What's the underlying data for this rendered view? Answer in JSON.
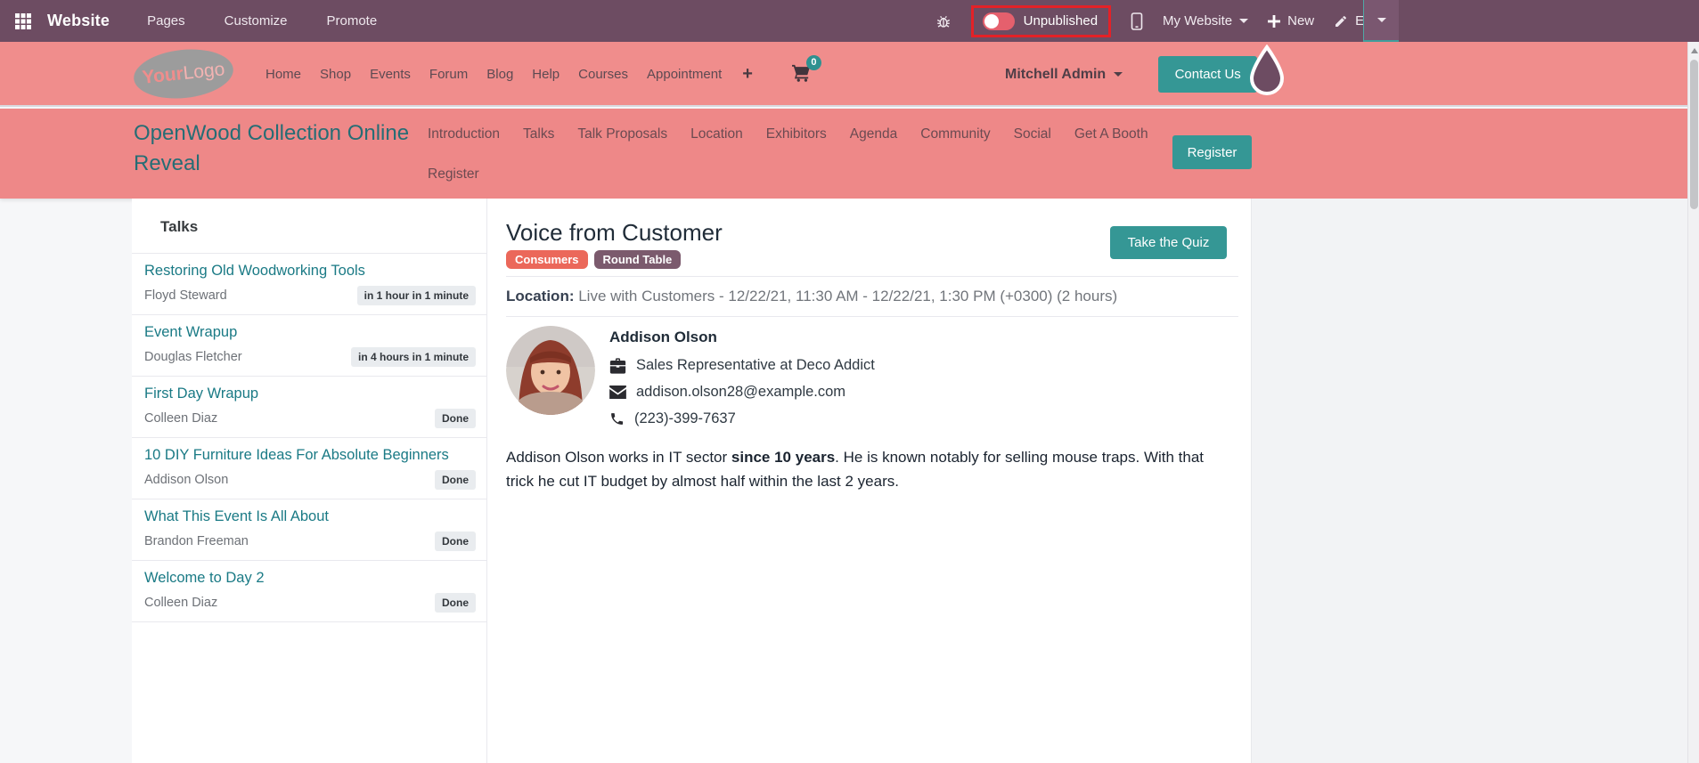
{
  "topbar": {
    "app_title": "Website",
    "menus": {
      "pages": "Pages",
      "customize": "Customize",
      "promote": "Promote"
    },
    "publish_status": "Unpublished",
    "my_website": "My Website",
    "new_label": "New",
    "edit_label": "Edit"
  },
  "navbar": {
    "logo": {
      "part1": "Your",
      "part2": "Logo"
    },
    "items": {
      "home": "Home",
      "shop": "Shop",
      "events": "Events",
      "forum": "Forum",
      "blog": "Blog",
      "help": "Help",
      "courses": "Courses",
      "appointment": "Appointment"
    },
    "cart_count": "0",
    "user_name": "Mitchell Admin",
    "contact_button": "Contact Us"
  },
  "event_header": {
    "title": "OpenWood Collection Online Reveal",
    "menu": {
      "introduction": "Introduction",
      "talks": "Talks",
      "talk_proposals": "Talk Proposals",
      "location": "Location",
      "exhibitors": "Exhibitors",
      "agenda": "Agenda",
      "community": "Community",
      "social": "Social",
      "get_a_booth": "Get A Booth",
      "register": "Register"
    },
    "register_button": "Register"
  },
  "sidebar": {
    "title": "Talks",
    "talks": [
      {
        "title": "Restoring Old Woodworking Tools",
        "speaker": "Floyd Steward",
        "status": "in 1 hour in 1 minute"
      },
      {
        "title": "Event Wrapup",
        "speaker": "Douglas Fletcher",
        "status": "in 4 hours in 1 minute"
      },
      {
        "title": "First Day Wrapup",
        "speaker": "Colleen Diaz",
        "status": "Done"
      },
      {
        "title": "10 DIY Furniture Ideas For Absolute Beginners",
        "speaker": "Addison Olson",
        "status": "Done"
      },
      {
        "title": "What This Event Is All About",
        "speaker": "Brandon Freeman",
        "status": "Done"
      },
      {
        "title": "Welcome to Day 2",
        "speaker": "Colleen Diaz",
        "status": "Done"
      }
    ]
  },
  "main": {
    "title": "Voice from Customer",
    "tags": [
      {
        "label": "Consumers",
        "color": "#eb685a"
      },
      {
        "label": "Round Table",
        "color": "#7b5a6d"
      }
    ],
    "quiz_button": "Take the Quiz",
    "location_label": "Location:",
    "location_value": " Live with Customers - 12/22/21, 11:30 AM - 12/22/21, 1:30 PM (+0300) (2 hours)",
    "speaker": {
      "name": "Addison Olson",
      "role": "Sales Representative at Deco Addict",
      "email": "addison.olson28@example.com",
      "phone": "(223)-399-7637",
      "bio_part1": "Addison Olson works in IT sector ",
      "bio_bold": "since 10 years",
      "bio_part2": ". He is known notably for selling mouse traps. With that trick he cut IT budget by almost half within the last 2 years."
    }
  },
  "colors": {
    "topbar_bg": "#6d4c62",
    "navbar_pink": "#f08d8c",
    "event_header_pink": "#ee8888",
    "accent_teal": "#359795",
    "alert_red": "#e42127",
    "toggle_red": "#e5606d",
    "link_teal": "#1a7a85",
    "title_teal": "#266d75"
  }
}
